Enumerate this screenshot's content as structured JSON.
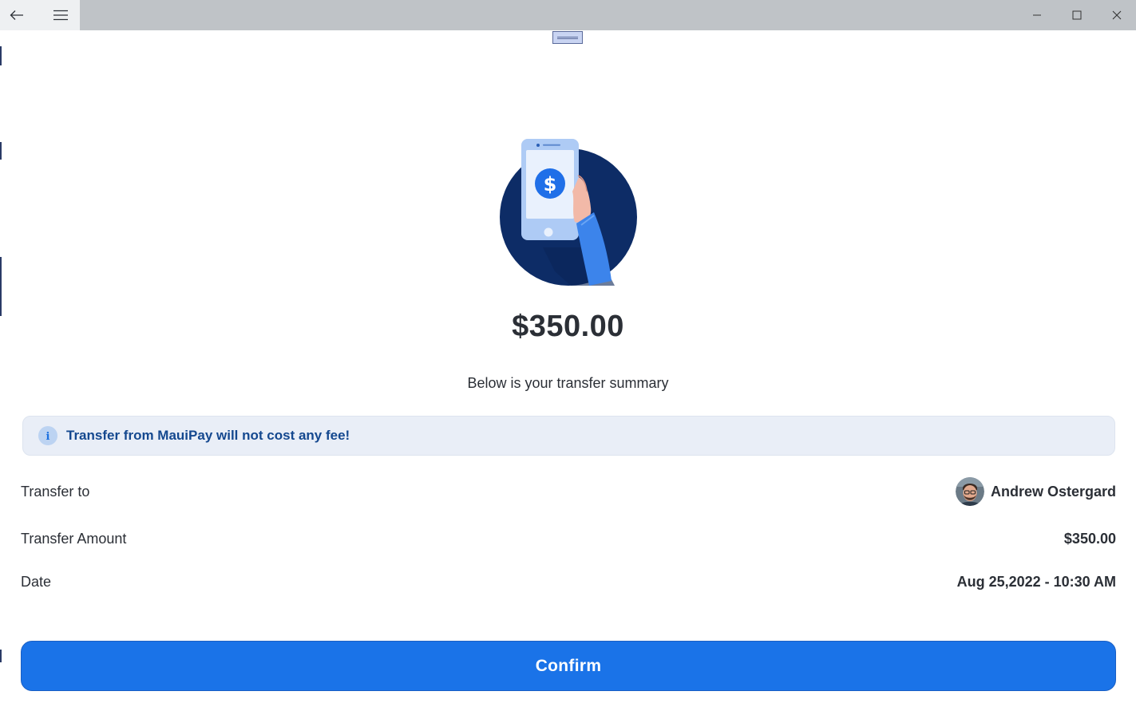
{
  "window": {
    "back_icon": "arrow-left-icon",
    "menu_icon": "hamburger-menu-icon",
    "minimize_icon": "minimize-icon",
    "maximize_icon": "maximize-icon",
    "close_icon": "close-icon"
  },
  "colors": {
    "primary": "#1a73e8",
    "banner_bg": "#e9eef7",
    "banner_text": "#14488f",
    "illustration_circle": "#0d2c66"
  },
  "summary": {
    "amount": "$350.00",
    "subtitle": "Below is your transfer summary",
    "info_icon": "info-icon",
    "info_text": "Transfer from MauiPay will not cost any fee!",
    "rows": [
      {
        "label": "Transfer to",
        "value": "Andrew Ostergard",
        "avatar_icon": "user-avatar"
      },
      {
        "label": "Transfer Amount",
        "value": "$350.00"
      },
      {
        "label": "Date",
        "value": "Aug 25,2022 - 10:30 AM"
      }
    ]
  },
  "confirm_label": "Confirm"
}
